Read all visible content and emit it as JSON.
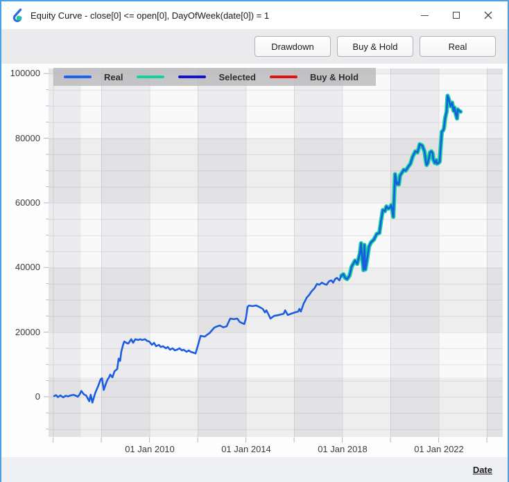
{
  "window": {
    "title": "Equity Curve - close[0] <= open[0], DayOfWeek(date[0]) = 1",
    "controls": {
      "minimize": "minimize",
      "maximize": "maximize",
      "close": "close"
    }
  },
  "toolbar": {
    "buttons": [
      "Drawdown",
      "Buy & Hold",
      "Real"
    ]
  },
  "legend": [
    {
      "label": "Real",
      "color": "#1e63ee"
    },
    {
      "label": "",
      "color": "#0fd49c"
    },
    {
      "label": "Selected",
      "color": "#1212d0"
    },
    {
      "label": "Buy & Hold",
      "color": "#e01313"
    }
  ],
  "axis": {
    "x_label": "Date"
  },
  "chart_data": {
    "type": "line",
    "title": "Equity Curve",
    "xlabel": "Date",
    "ylabel": "",
    "xlim": [
      2005.81,
      2024.66
    ],
    "ylim": [
      -12450,
      101550
    ],
    "grid": "minor horizontal every 5000, checkerboard bands every 2 years / 20000 units",
    "legend_position": "top",
    "x_major_ticks": [
      {
        "year": 2010,
        "label": "01 Jan 2010"
      },
      {
        "year": 2014,
        "label": "01 Jan 2014"
      },
      {
        "year": 2018,
        "label": "01 Jan 2018"
      },
      {
        "year": 2022,
        "label": "01 Jan 2022"
      }
    ],
    "x_minor_tick_years": [
      2006,
      2008,
      2010,
      2012,
      2014,
      2016,
      2018,
      2020,
      2022,
      2024
    ],
    "y_ticks": [
      {
        "value": 100000,
        "label": "100000"
      },
      {
        "value": 80000,
        "label": "80000"
      },
      {
        "value": 60000,
        "label": "60000"
      },
      {
        "value": 40000,
        "label": "40000"
      },
      {
        "value": 20000,
        "label": "20000"
      },
      {
        "value": 0,
        "label": "0"
      }
    ],
    "y_minor_step": 5000,
    "series": [
      {
        "name": "Real",
        "color": "#1b5ce2",
        "width": 2.6,
        "points": [
          [
            2006.04,
            200
          ],
          [
            2006.12,
            500
          ],
          [
            2006.2,
            -100
          ],
          [
            2006.3,
            400
          ],
          [
            2006.42,
            -200
          ],
          [
            2006.52,
            300
          ],
          [
            2006.62,
            100
          ],
          [
            2006.72,
            400
          ],
          [
            2006.85,
            600
          ],
          [
            2006.95,
            300
          ],
          [
            2007.02,
            0
          ],
          [
            2007.1,
            700
          ],
          [
            2007.17,
            1800
          ],
          [
            2007.28,
            700
          ],
          [
            2007.37,
            400
          ],
          [
            2007.5,
            -1400
          ],
          [
            2007.56,
            650
          ],
          [
            2007.63,
            -1800
          ],
          [
            2007.75,
            1200
          ],
          [
            2007.88,
            3500
          ],
          [
            2007.97,
            5400
          ],
          [
            2008.03,
            5700
          ],
          [
            2008.1,
            2100
          ],
          [
            2008.17,
            3600
          ],
          [
            2008.25,
            5200
          ],
          [
            2008.32,
            6000
          ],
          [
            2008.37,
            6850
          ],
          [
            2008.46,
            6000
          ],
          [
            2008.55,
            7900
          ],
          [
            2008.66,
            8550
          ],
          [
            2008.72,
            11800
          ],
          [
            2008.78,
            11100
          ],
          [
            2008.83,
            13900
          ],
          [
            2008.9,
            16000
          ],
          [
            2008.95,
            17100
          ],
          [
            2009.04,
            16700
          ],
          [
            2009.12,
            16450
          ],
          [
            2009.24,
            17800
          ],
          [
            2009.32,
            16700
          ],
          [
            2009.41,
            17800
          ],
          [
            2009.53,
            17550
          ],
          [
            2009.61,
            17800
          ],
          [
            2009.7,
            17550
          ],
          [
            2009.81,
            17800
          ],
          [
            2009.9,
            17300
          ],
          [
            2009.99,
            17100
          ],
          [
            2010.1,
            16050
          ],
          [
            2010.19,
            16700
          ],
          [
            2010.27,
            15650
          ],
          [
            2010.39,
            16050
          ],
          [
            2010.47,
            15400
          ],
          [
            2010.56,
            15650
          ],
          [
            2010.68,
            15000
          ],
          [
            2010.76,
            15400
          ],
          [
            2010.85,
            14550
          ],
          [
            2010.96,
            15000
          ],
          [
            2011.05,
            14350
          ],
          [
            2011.14,
            14550
          ],
          [
            2011.25,
            15000
          ],
          [
            2011.34,
            14350
          ],
          [
            2011.42,
            14550
          ],
          [
            2011.54,
            13900
          ],
          [
            2011.63,
            14350
          ],
          [
            2011.71,
            13900
          ],
          [
            2011.83,
            13600
          ],
          [
            2011.91,
            13400
          ],
          [
            2012.0,
            15650
          ],
          [
            2012.12,
            18850
          ],
          [
            2012.29,
            18600
          ],
          [
            2012.4,
            19250
          ],
          [
            2012.49,
            19700
          ],
          [
            2012.69,
            21400
          ],
          [
            2012.78,
            21700
          ],
          [
            2012.92,
            22050
          ],
          [
            2013.06,
            21500
          ],
          [
            2013.2,
            21800
          ],
          [
            2013.35,
            24200
          ],
          [
            2013.5,
            24000
          ],
          [
            2013.64,
            24200
          ],
          [
            2013.75,
            23100
          ],
          [
            2013.93,
            22500
          ],
          [
            2014.0,
            24200
          ],
          [
            2014.07,
            27800
          ],
          [
            2014.13,
            28250
          ],
          [
            2014.27,
            28050
          ],
          [
            2014.42,
            28250
          ],
          [
            2014.56,
            27800
          ],
          [
            2014.7,
            27200
          ],
          [
            2014.79,
            26100
          ],
          [
            2014.85,
            26750
          ],
          [
            2014.95,
            25300
          ],
          [
            2015.02,
            24200
          ],
          [
            2015.17,
            25000
          ],
          [
            2015.37,
            25300
          ],
          [
            2015.57,
            25700
          ],
          [
            2015.63,
            26750
          ],
          [
            2015.74,
            25300
          ],
          [
            2015.88,
            25700
          ],
          [
            2016.03,
            26100
          ],
          [
            2016.17,
            26350
          ],
          [
            2016.22,
            27200
          ],
          [
            2016.28,
            26350
          ],
          [
            2016.35,
            27800
          ],
          [
            2016.4,
            28900
          ],
          [
            2016.45,
            29550
          ],
          [
            2016.52,
            30650
          ],
          [
            2016.62,
            31450
          ],
          [
            2016.72,
            32550
          ],
          [
            2016.85,
            33600
          ],
          [
            2016.95,
            34900
          ],
          [
            2017.05,
            34650
          ],
          [
            2017.15,
            35300
          ],
          [
            2017.25,
            34900
          ],
          [
            2017.35,
            34650
          ],
          [
            2017.45,
            35750
          ],
          [
            2017.55,
            36000
          ],
          [
            2017.62,
            35300
          ],
          [
            2017.7,
            36400
          ],
          [
            2017.78,
            36800
          ],
          [
            2017.88,
            36000
          ],
          [
            2017.96,
            37450
          ],
          [
            2018.05,
            37900
          ],
          [
            2018.12,
            36800
          ],
          [
            2018.2,
            36400
          ],
          [
            2018.3,
            37450
          ],
          [
            2018.39,
            40250
          ],
          [
            2018.53,
            42150
          ],
          [
            2018.62,
            41100
          ],
          [
            2018.73,
            44300
          ],
          [
            2018.78,
            47500
          ],
          [
            2018.82,
            43450
          ],
          [
            2018.88,
            39200
          ],
          [
            2018.92,
            47000
          ],
          [
            2018.96,
            39400
          ],
          [
            2019.02,
            42000
          ],
          [
            2019.11,
            46450
          ],
          [
            2019.19,
            47750
          ],
          [
            2019.31,
            48600
          ],
          [
            2019.43,
            50400
          ],
          [
            2019.54,
            50700
          ],
          [
            2019.6,
            54000
          ],
          [
            2019.68,
            57800
          ],
          [
            2019.77,
            57400
          ],
          [
            2019.83,
            58900
          ],
          [
            2019.91,
            58200
          ],
          [
            2019.97,
            58450
          ],
          [
            2020.03,
            59300
          ],
          [
            2020.06,
            58200
          ],
          [
            2020.12,
            55650
          ],
          [
            2020.19,
            68900
          ],
          [
            2020.26,
            65700
          ],
          [
            2020.32,
            66350
          ],
          [
            2020.35,
            65700
          ],
          [
            2020.4,
            68500
          ],
          [
            2020.46,
            69150
          ],
          [
            2020.55,
            70250
          ],
          [
            2020.63,
            69950
          ],
          [
            2020.75,
            71300
          ],
          [
            2020.83,
            72100
          ],
          [
            2020.92,
            74250
          ],
          [
            2021.03,
            75950
          ],
          [
            2021.12,
            75600
          ],
          [
            2021.18,
            77100
          ],
          [
            2021.21,
            78150
          ],
          [
            2021.32,
            77750
          ],
          [
            2021.41,
            75950
          ],
          [
            2021.47,
            72750
          ],
          [
            2021.5,
            71700
          ],
          [
            2021.55,
            72350
          ],
          [
            2021.61,
            74250
          ],
          [
            2021.64,
            75600
          ],
          [
            2021.7,
            75950
          ],
          [
            2021.75,
            75350
          ],
          [
            2021.78,
            73400
          ],
          [
            2021.84,
            72350
          ],
          [
            2021.9,
            73200
          ],
          [
            2021.93,
            72100
          ],
          [
            2021.99,
            72350
          ],
          [
            2022.04,
            72750
          ],
          [
            2022.07,
            75950
          ],
          [
            2022.13,
            82000
          ],
          [
            2022.19,
            82450
          ],
          [
            2022.22,
            83100
          ],
          [
            2022.27,
            86300
          ],
          [
            2022.33,
            88200
          ],
          [
            2022.37,
            93150
          ],
          [
            2022.42,
            92050
          ],
          [
            2022.47,
            90550
          ],
          [
            2022.5,
            89900
          ],
          [
            2022.56,
            91000
          ],
          [
            2022.62,
            88450
          ],
          [
            2022.65,
            89500
          ],
          [
            2022.7,
            87800
          ],
          [
            2022.76,
            86100
          ],
          [
            2022.79,
            88900
          ],
          [
            2022.85,
            88450
          ],
          [
            2022.91,
            88200
          ]
        ]
      },
      {
        "name": "selected-highlight",
        "color": "#10d2a0",
        "width": 6,
        "overlay_of": "Real",
        "from_year": 2017.96
      }
    ]
  }
}
